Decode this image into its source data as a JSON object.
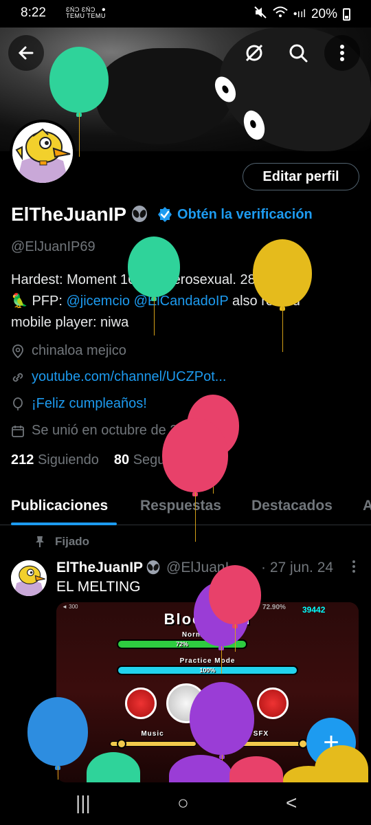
{
  "status_bar": {
    "time": "8:22",
    "notif_line_1": "ƐŃƆ ƐŃƆ",
    "notif_line_2": "TEMU TEMU",
    "dot": "•",
    "signal_text": "•ııl",
    "battery": "20%"
  },
  "header": {
    "back_icon": "arrow-left-icon",
    "grok_icon": "slash-circle-icon",
    "search_icon": "search-icon",
    "more_icon": "more-vertical-icon"
  },
  "profile": {
    "edit_label": "Editar perfil",
    "name": "ElTheJuanIP",
    "verify_label": "Obtén la verificación",
    "handle": "@ElJuanIP69",
    "bio_line1": "Hardest: Moment 16yo heterosexual. 28-12",
    "bio_parrot": "🦜",
    "bio_pfp": "PFP:",
    "bio_mention1": "@jicemcio",
    "bio_mention2": "@ElCandadoIP",
    "bio_rest": "also retired",
    "bio_line3": "mobile player: niwa",
    "location": "chinaloa mejico",
    "website": "youtube.com/channel/UCZPot...",
    "birthday": "¡Feliz cumpleaños!",
    "joined": "Se unió en octubre de 2017",
    "following_count": "212",
    "following_label": "Siguiendo",
    "followers_count": "80",
    "followers_label": "Seguidores"
  },
  "tabs": [
    "Publicaciones",
    "Respuestas",
    "Destacados",
    "A"
  ],
  "post": {
    "pinned_label": "Fijado",
    "author": "ElTheJuanIP",
    "handle": "@ElJuanI...",
    "date": "· 27 jun. 24",
    "text": "EL MELTING",
    "media": {
      "title": "Bloodbath",
      "normal_label": "Normal Mode",
      "normal_pct": "72%",
      "practice_label": "Practice Mode",
      "practice_pct": "100%",
      "music_label": "Music",
      "sfx_label": "SFX",
      "top_left": "◄ 300",
      "top_pct": "72.90%",
      "top_num": "39442"
    }
  },
  "fab_label": "+",
  "navbar": {
    "recents": "|||",
    "home": "○",
    "back": "<"
  },
  "colors": {
    "accent": "#1d9bf0",
    "background": "#000000",
    "muted": "#71767b"
  }
}
